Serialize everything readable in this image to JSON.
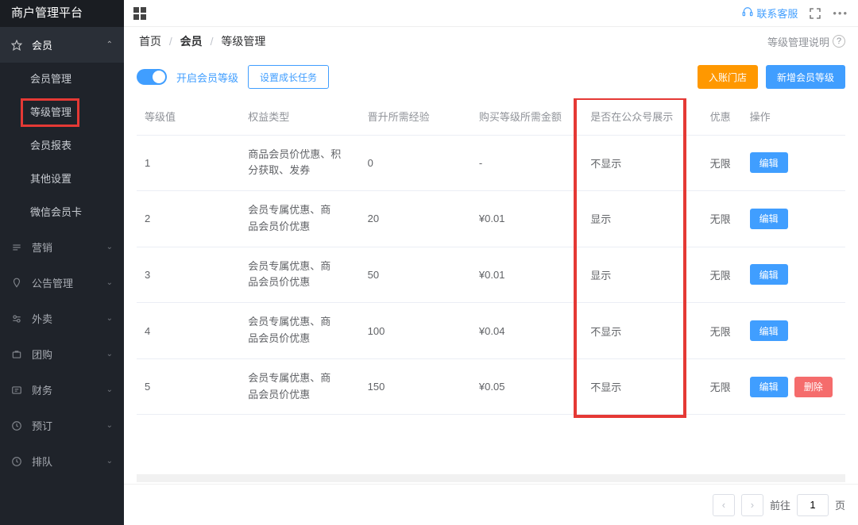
{
  "brand": "商户管理平台",
  "sidebar": {
    "member": {
      "label": "会员",
      "sub": [
        "会员管理",
        "等级管理",
        "会员报表",
        "其他设置",
        "微信会员卡"
      ]
    },
    "items": [
      "营销",
      "公告管理",
      "外卖",
      "团购",
      "财务",
      "预订",
      "排队"
    ]
  },
  "topbar": {
    "contact": "联系客服"
  },
  "breadcrumb": {
    "home": "首页",
    "sec": "会员",
    "third": "等级管理",
    "help": "等级管理说明"
  },
  "toolbar": {
    "switch": "开启会员等级",
    "task": "设置成长任务",
    "checkin": "入账门店",
    "add": "新增会员等级"
  },
  "table": {
    "headers": [
      "等级值",
      "权益类型",
      "晋升所需经验",
      "购买等级所需金额",
      "是否在公众号展示",
      "优惠",
      "操作"
    ],
    "rows": [
      {
        "level": "1",
        "benefit": "商品会员价优惠、积分获取、发券",
        "exp": "0",
        "cost": "-",
        "show": "不显示",
        "disc": "无限",
        "can_delete": false
      },
      {
        "level": "2",
        "benefit": "会员专属优惠、商品会员价优惠",
        "exp": "20",
        "cost": "¥0.01",
        "show": "显示",
        "disc": "无限",
        "can_delete": false
      },
      {
        "level": "3",
        "benefit": "会员专属优惠、商品会员价优惠",
        "exp": "50",
        "cost": "¥0.01",
        "show": "显示",
        "disc": "无限",
        "can_delete": false
      },
      {
        "level": "4",
        "benefit": "会员专属优惠、商品会员价优惠",
        "exp": "100",
        "cost": "¥0.04",
        "show": "不显示",
        "disc": "无限",
        "can_delete": false
      },
      {
        "level": "5",
        "benefit": "会员专属优惠、商品会员价优惠",
        "exp": "150",
        "cost": "¥0.05",
        "show": "不显示",
        "disc": "无限",
        "can_delete": true
      }
    ]
  },
  "ops": {
    "edit": "编辑",
    "delete": "删除"
  },
  "pager": {
    "goto": "前往",
    "page": "1",
    "unit": "页"
  }
}
